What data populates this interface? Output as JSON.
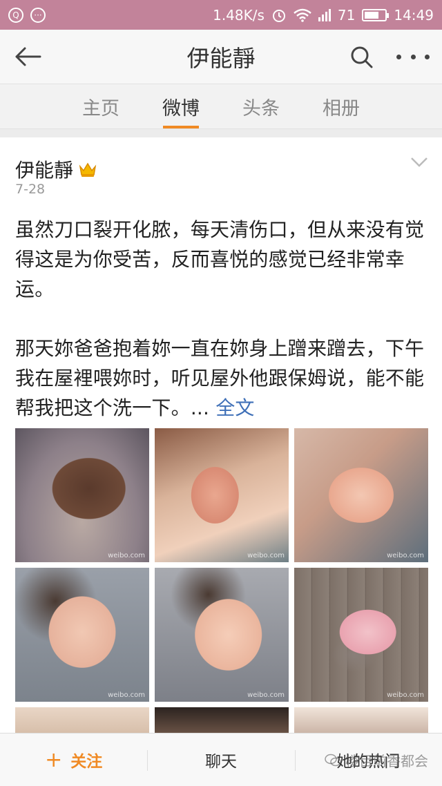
{
  "status_bar": {
    "speed": "1.48K/s",
    "battery": "71",
    "battery_level": 0.71,
    "time": "14:49"
  },
  "header": {
    "title": "伊能靜"
  },
  "tabs": [
    {
      "label": "主页",
      "active": false
    },
    {
      "label": "微博",
      "active": true
    },
    {
      "label": "头条",
      "active": false
    },
    {
      "label": "相册",
      "active": false
    }
  ],
  "post": {
    "author": "伊能靜",
    "date": "7-28",
    "paragraph1": "虽然刀口裂开化脓，每天清伤口，但从来没有觉得这是为你受苦，反而喜悦的感觉已经非常幸运。",
    "paragraph2": "那天妳爸爸抱着妳一直在妳身上蹭来蹭去，下午我在屋裡喂妳时，听见屋外他跟保姆说，能不能帮我把这个洗一下。",
    "ellipsis": "...",
    "full_text_link": "全文",
    "photo_watermark": "weibo.com"
  },
  "bottom_bar": {
    "follow_label": "关注",
    "chat_label": "聊天",
    "hot_label": "她的热门"
  },
  "overlay_watermark": "楼目前香都会",
  "colors": {
    "status_bar": "#c2839a",
    "accent": "#f08a24",
    "link": "#3e6fb7"
  }
}
